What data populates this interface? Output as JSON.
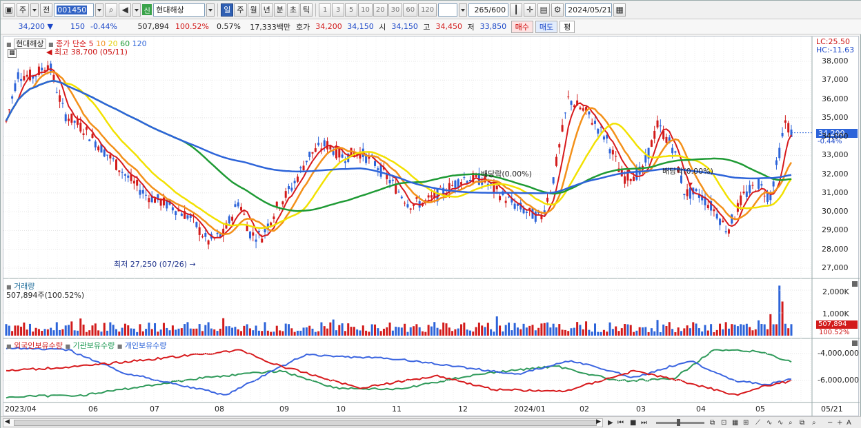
{
  "toolbar": {
    "period_type": "주",
    "prev_label": "전",
    "stock_code": "001450",
    "sin_badge": "신",
    "stock_name": "현대해상",
    "periods": [
      "일",
      "주",
      "월",
      "년",
      "분",
      "초",
      "틱"
    ],
    "active_period": "일",
    "minutes": [
      "1",
      "3",
      "5",
      "10",
      "20",
      "30",
      "60",
      "120"
    ],
    "count": "265",
    "count_total": "600",
    "date": "2024/05/21"
  },
  "quote": {
    "price": "34,200",
    "change": "150",
    "change_pct": "-0.44%",
    "volume": "507,894",
    "volume_ratio": "100.52%",
    "turnover_rate": "0.57%",
    "amount": "17,333백만",
    "ask_label": "호가",
    "ask": "34,200",
    "bid": "34,150",
    "open_label": "시",
    "open": "34,150",
    "high_label": "고",
    "high": "34,450",
    "low_label": "저",
    "low": "33,850",
    "buy_button": "매수",
    "sell_button": "매도",
    "avg_button": "평"
  },
  "price_panel": {
    "name": "현대해상",
    "ma_label": "종가 단순",
    "ma_periods": [
      {
        "label": "5",
        "color": "#d7191c"
      },
      {
        "label": "10",
        "color": "#f39019"
      },
      {
        "label": "20",
        "color": "#f2e100"
      },
      {
        "label": "60",
        "color": "#1e9a34"
      },
      {
        "label": "120",
        "color": "#2d64d9"
      }
    ],
    "high_note": "최고 38,700 (05/11)",
    "low_note": "최저 27,250 (07/26)",
    "dividend_note_1": "배당락(0.00%)",
    "dividend_note_2": "배당락(0.00%)",
    "lc": "LC:25.50",
    "hc": "HC:-11.63",
    "current_price_tag": "34,200",
    "current_pct_tag": "-0.44%",
    "y_ticks": [
      "38,000",
      "37,000",
      "36,000",
      "35,000",
      "34,000",
      "33,000",
      "32,000",
      "31,000",
      "30,000",
      "29,000",
      "28,000",
      "27,000"
    ]
  },
  "volume_panel": {
    "title": "거래량",
    "subtitle": "507,894주(100.52%)",
    "y_ticks": [
      "2,000K",
      "1,000K"
    ],
    "tag_value": "507,894",
    "tag_pct": "100.52%"
  },
  "holdings_panel": {
    "legend": [
      "외국인보유수량",
      "기관보유수량",
      "개인보유수량"
    ],
    "y_ticks": [
      "-4,000,000",
      "-6,000,000"
    ]
  },
  "x_axis": [
    "2023/04",
    "06",
    "07",
    "08",
    "09",
    "10",
    "11",
    "12",
    "2024/01",
    "02",
    "03",
    "04",
    "05",
    "05/21"
  ],
  "colors": {
    "up": "#d21b1b",
    "down": "#2d64d9",
    "ma5": "#d7191c",
    "ma10": "#f39019",
    "ma20": "#f2e100",
    "ma60": "#1e9a34",
    "ma120": "#2d64d9"
  }
}
